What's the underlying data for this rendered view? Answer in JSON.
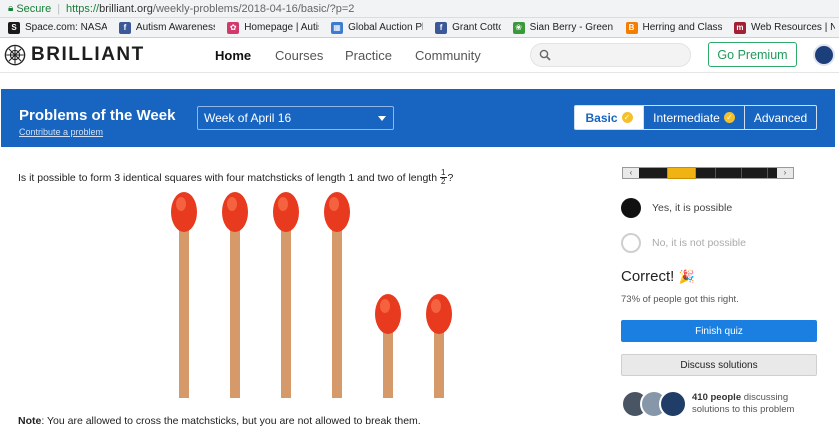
{
  "address_bar": {
    "secure_label": "Secure",
    "https": "https://",
    "domain": "brilliant.org",
    "path": "/weekly-problems/2018-04-16/basic/?p=2"
  },
  "bookmarks": [
    {
      "label": "Space.com: NASA, S",
      "icon": "space-com-icon",
      "color": "#1a1a1a",
      "glyph": "S"
    },
    {
      "label": "Autism Awareness C",
      "icon": "facebook-icon",
      "color": "#3b5998",
      "glyph": "f"
    },
    {
      "label": "Homepage | Autism",
      "icon": "autism-icon",
      "color": "#d23a6b",
      "glyph": "✿"
    },
    {
      "label": "Global Auction Platf",
      "icon": "auction-icon",
      "color": "#3d7bd1",
      "glyph": "▦"
    },
    {
      "label": "Grant Cotton",
      "icon": "facebook-icon",
      "color": "#3b5998",
      "glyph": "f"
    },
    {
      "label": "Sian Berry - Green Lo",
      "icon": "green-party-icon",
      "color": "#3a9a3a",
      "glyph": "❀"
    },
    {
      "label": "Herring and Class St",
      "icon": "blogger-icon",
      "color": "#f57d00",
      "glyph": "B"
    },
    {
      "label": "Web Resources | Neu",
      "icon": "web-resources-icon",
      "color": "#a31f34",
      "glyph": "m"
    }
  ],
  "header": {
    "logo_text": "BRILLIANT",
    "nav": [
      "Home",
      "Courses",
      "Practice",
      "Community"
    ],
    "search_placeholder": "",
    "premium_label": "Go Premium"
  },
  "banner": {
    "title": "Problems of the Week",
    "subtitle": "Contribute a problem",
    "week": "Week of April 16",
    "levels": [
      {
        "label": "Basic",
        "checked": true,
        "active": true
      },
      {
        "label": "Intermediate",
        "checked": true,
        "active": false
      },
      {
        "label": "Advanced",
        "checked": false,
        "active": false
      }
    ]
  },
  "problem": {
    "question": "Is it possible to form 3 identical squares with four matchsticks of length 1 and two of length",
    "frac_num": "1",
    "frac_den": "2",
    "question_end": "?",
    "note_label": "Note",
    "note_text": ": You are allowed to cross the matchsticks, but you are not allowed to break them.",
    "matchsticks": [
      1,
      1,
      1,
      1,
      0.5,
      0.5
    ],
    "match_head_color": "#e83a1f",
    "match_stick_color": "#d6996a"
  },
  "panel": {
    "option_yes": "Yes, it is possible",
    "option_no": "No, it is not possible",
    "selected": "yes",
    "correct_label": "Correct!",
    "correct_emoji": "🎉",
    "percent_text": "73% of people got this right.",
    "finish_label": "Finish quiz",
    "discuss_label": "Discuss solutions",
    "discussion_count": "410 people",
    "discussion_text": " discussing solutions to this problem"
  }
}
